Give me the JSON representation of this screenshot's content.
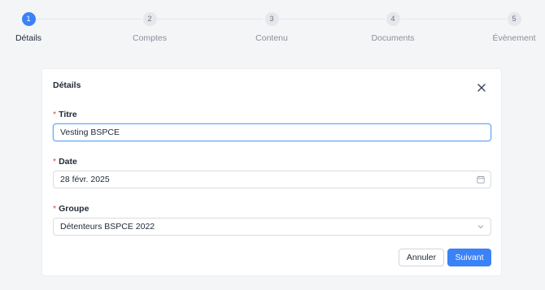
{
  "stepper": {
    "steps": [
      {
        "number": "1",
        "label": "Détails"
      },
      {
        "number": "2",
        "label": "Comptes"
      },
      {
        "number": "3",
        "label": "Contenu"
      },
      {
        "number": "4",
        "label": "Documents"
      },
      {
        "number": "5",
        "label": "Évènement"
      }
    ],
    "active_step": 1,
    "accent_color": "#3b82f6"
  },
  "dialog": {
    "title": "Détails",
    "close_icon": "close-icon",
    "required_mark": "*",
    "fields": {
      "title": {
        "label": "Titre",
        "value": "Vesting BSPCE"
      },
      "date": {
        "label": "Date",
        "value": "28 févr. 2025",
        "icon": "calendar-icon"
      },
      "group": {
        "label": "Groupe",
        "value": "Détenteurs BSPCE 2022",
        "icon": "chevron-down-icon"
      }
    },
    "cancel_label": "Annuler",
    "next_label": "Suivant"
  }
}
